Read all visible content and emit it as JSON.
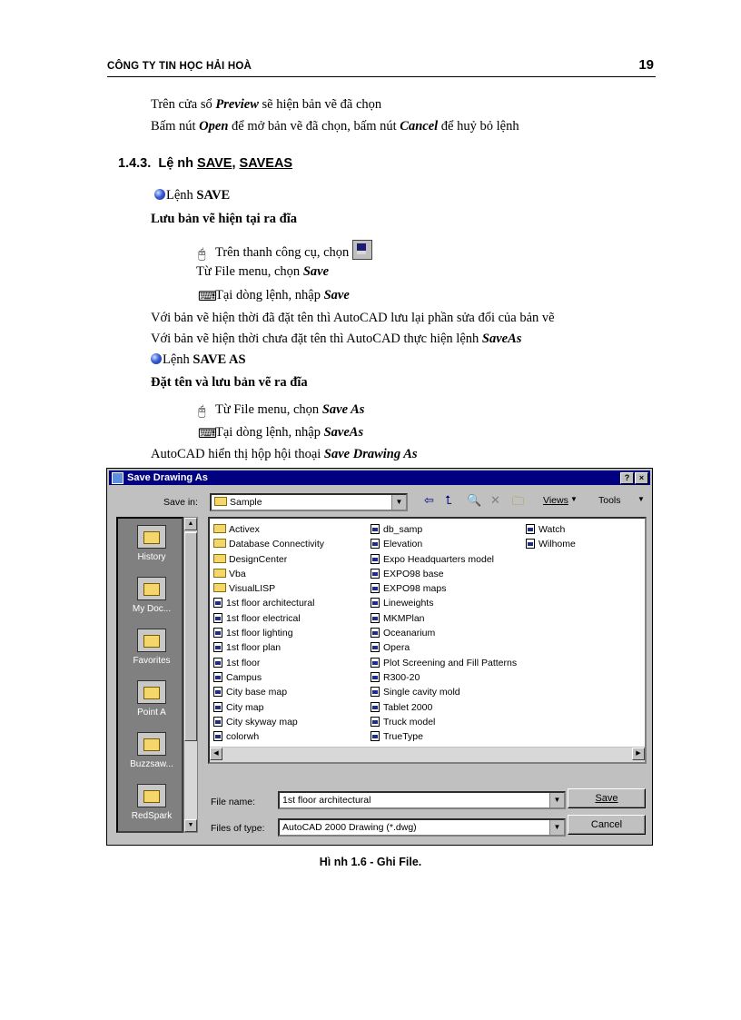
{
  "header": {
    "company": "CÔNG TY TIN HỌC HẢI HOÀ",
    "page_number": "19"
  },
  "intro": {
    "l1_a": "Trên cửa sổ ",
    "l1_b": "Preview",
    "l1_c": " sẽ hiện bản vẽ đã chọn",
    "l2_a": "Bấm nút ",
    "l2_b": "Open",
    "l2_c": " để mở bản vẽ đã chọn, bấm nút ",
    "l2_d": "Cancel",
    "l2_e": " để huỷ bỏ lệnh"
  },
  "section": {
    "number": "1.4.3.",
    "word": "Lệ nh ",
    "cmd1": "SAVE",
    "sep": ", ",
    "cmd2": "SAVEAS"
  },
  "save": {
    "bullet_a": "Lệnh ",
    "bullet_b": "SAVE",
    "subhead": "Lưu bản vẽ hiện tại ra đĩa",
    "toolbar": "Trên thanh công cụ, chọn",
    "menu_a": "Từ File menu, chọn ",
    "menu_b": "Save",
    "cmd_a": "Tại dòng lệnh, nhập ",
    "cmd_b": "Save",
    "note1": "Với bản vẽ hiện thời đã đặt tên thì AutoCAD  lưu lại phần sửa đổi của bản vẽ",
    "note2_a": "Với bản vẽ hiện thời chưa đặt tên thì AutoCAD  thực hiện lệnh ",
    "note2_b": "SaveAs"
  },
  "saveas": {
    "bullet_a": "Lệnh ",
    "bullet_b": "SAVE AS",
    "subhead": "Đặt tên và lưu bản vẽ ra đĩa",
    "menu_a": "Từ File menu, chọn ",
    "menu_b": "Save As",
    "cmd_a": "Tại dòng lệnh, nhập ",
    "cmd_b": "SaveAs",
    "dialog_a": "AutoCAD  hiển thị hộp hội thoại ",
    "dialog_b": "Save Drawing As"
  },
  "dialog": {
    "title": "Save Drawing As",
    "help_btn": "?",
    "close_btn": "×",
    "save_in_label": "Save in:",
    "save_in_value": "Sample",
    "views_label": "Views",
    "tools_label": "Tools",
    "places": [
      "History",
      "My Doc...",
      "Favorites",
      "Point A",
      "Buzzsaw...",
      "RedSpark"
    ],
    "col1": [
      "Activex",
      "Database Connectivity",
      "DesignCenter",
      "Vba",
      "VisualLISP",
      "1st floor architectural",
      "1st floor electrical",
      "1st floor lighting",
      "1st floor plan",
      "1st floor",
      "Campus",
      "City base map",
      "City map",
      "City skyway map",
      "colorwh"
    ],
    "col2": [
      "db_samp",
      "Elevation",
      "Expo Headquarters model",
      "EXPO98 base",
      "EXPO98 maps",
      "Lineweights",
      "MKMPlan",
      "Oceanarium",
      "Opera",
      "Plot Screening and Fill Patterns",
      "R300-20",
      "Single cavity mold",
      "Tablet 2000",
      "Truck model",
      "TrueType"
    ],
    "col3": [
      "Watch",
      "Wilhome"
    ],
    "file_name_label": "File name:",
    "file_name_value": "1st floor architectural",
    "file_type_label": "Files of type:",
    "file_type_value": "AutoCAD 2000 Drawing (*.dwg)",
    "save_button": "Save",
    "cancel_button": "Cancel"
  },
  "caption": "Hì nh 1.6 - Ghi File."
}
